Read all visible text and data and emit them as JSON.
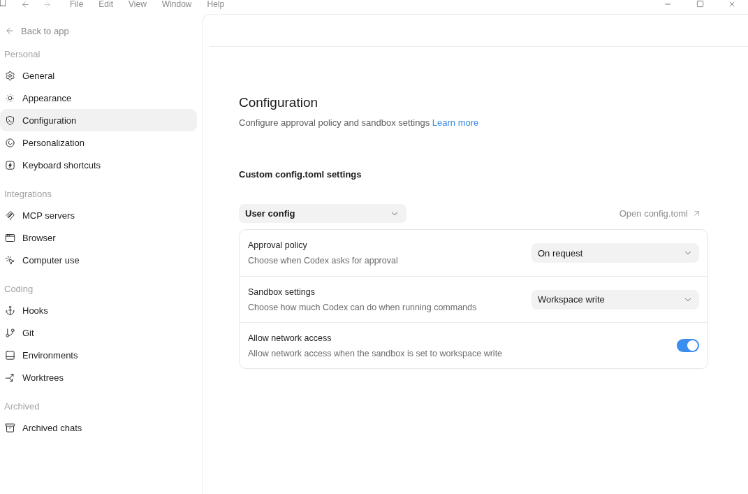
{
  "title_bar": {
    "nav_buttons": [
      {
        "disabled": false
      },
      {
        "disabled": true
      }
    ],
    "menu": [
      "File",
      "Edit",
      "View",
      "Window",
      "Help"
    ]
  },
  "sidebar": {
    "back_link": "Back to app",
    "sections": [
      {
        "heading": "Personal",
        "items": [
          {
            "label": "General",
            "selected": false
          },
          {
            "label": "Appearance",
            "selected": false
          },
          {
            "label": "Configuration",
            "selected": true
          },
          {
            "label": "Personalization",
            "selected": false
          },
          {
            "label": "Keyboard shortcuts",
            "selected": false
          }
        ]
      },
      {
        "heading": "Integrations",
        "items": [
          {
            "label": "MCP servers",
            "selected": false
          },
          {
            "label": "Browser",
            "selected": false
          },
          {
            "label": "Computer use",
            "selected": false
          }
        ]
      },
      {
        "heading": "Coding",
        "items": [
          {
            "label": "Hooks",
            "selected": false
          },
          {
            "label": "Git",
            "selected": false
          },
          {
            "label": "Environments",
            "selected": false
          },
          {
            "label": "Worktrees",
            "selected": false
          }
        ]
      },
      {
        "heading": "Archived",
        "items": [
          {
            "label": "Archived chats",
            "selected": false
          }
        ]
      }
    ]
  },
  "page": {
    "title": "Configuration",
    "description": "Configure approval policy and sandbox settings",
    "link": "Learn more"
  },
  "config": {
    "heading": "Custom config.toml settings",
    "scope_select": {
      "value": "User config"
    },
    "open_link": "Open config.toml",
    "settings": [
      {
        "kind": "select",
        "label": "Approval policy",
        "description": "Choose when Codex asks for approval",
        "value": "On request"
      },
      {
        "kind": "select",
        "label": "Sandbox settings",
        "description": "Choose how much Codex can do when running commands",
        "value": "Workspace write"
      },
      {
        "kind": "toggle",
        "label": "Allow network access",
        "description": "Allow network access when the sandbox is set to workspace write",
        "on": true
      }
    ]
  }
}
